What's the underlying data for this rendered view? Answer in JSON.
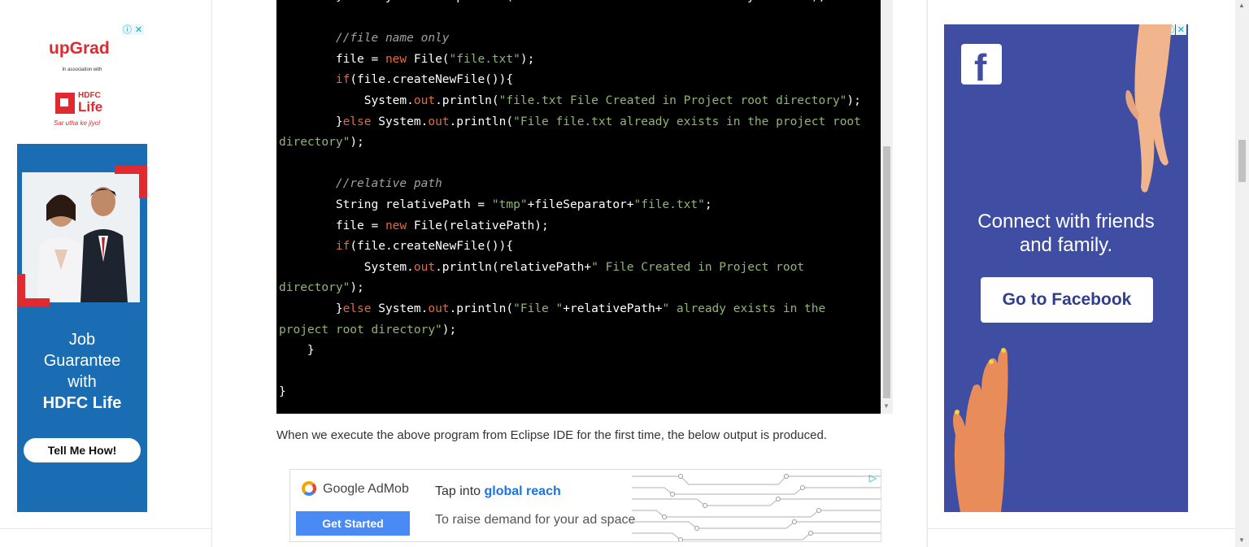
{
  "left_ad": {
    "brand": "upGrad",
    "association": "In association with",
    "partner_top": "HDFC",
    "partner_bottom": "Life",
    "tagline": "Sar utha ke jiyo!",
    "headline_lines": [
      "Job",
      "Guarantee",
      "with"
    ],
    "headline_bold": "HDFC Life",
    "cta": "Tell Me How!",
    "badge_info": "ⓘ",
    "badge_close": "✕"
  },
  "code": {
    "lines": [
      [
        {
          "t": "        }else System.out.println(\"File \"+absoluteFilePath+\" already exists\");",
          "c": ""
        }
      ],
      [
        {
          "t": "",
          "c": ""
        }
      ],
      [
        {
          "t": "        ",
          "c": ""
        },
        {
          "t": "//file name only",
          "c": "c-com"
        }
      ],
      [
        {
          "t": "        file = ",
          "c": ""
        },
        {
          "t": "new",
          "c": "c-kw"
        },
        {
          "t": " File(",
          "c": ""
        },
        {
          "t": "\"file.txt\"",
          "c": "c-str"
        },
        {
          "t": ");",
          "c": ""
        }
      ],
      [
        {
          "t": "        ",
          "c": ""
        },
        {
          "t": "if",
          "c": "c-kw"
        },
        {
          "t": "(file.createNewFile()){",
          "c": ""
        }
      ],
      [
        {
          "t": "            System.",
          "c": ""
        },
        {
          "t": "out",
          "c": "c-fld"
        },
        {
          "t": ".println(",
          "c": ""
        },
        {
          "t": "\"file.txt File Created in Project root directory\"",
          "c": "c-str"
        },
        {
          "t": ");",
          "c": ""
        }
      ],
      [
        {
          "t": "        }",
          "c": ""
        },
        {
          "t": "else",
          "c": "c-kw"
        },
        {
          "t": " System.",
          "c": ""
        },
        {
          "t": "out",
          "c": "c-fld"
        },
        {
          "t": ".println(",
          "c": ""
        },
        {
          "t": "\"File file.txt already exists in the project root",
          "c": "c-str"
        }
      ],
      [
        {
          "t": "directory\"",
          "c": "c-str"
        },
        {
          "t": ");",
          "c": ""
        }
      ],
      [
        {
          "t": "",
          "c": ""
        }
      ],
      [
        {
          "t": "        ",
          "c": ""
        },
        {
          "t": "//relative path",
          "c": "c-com"
        }
      ],
      [
        {
          "t": "        String relativePath = ",
          "c": ""
        },
        {
          "t": "\"tmp\"",
          "c": "c-str"
        },
        {
          "t": "+fileSeparator+",
          "c": ""
        },
        {
          "t": "\"file.txt\"",
          "c": "c-str"
        },
        {
          "t": ";",
          "c": ""
        }
      ],
      [
        {
          "t": "        file = ",
          "c": ""
        },
        {
          "t": "new",
          "c": "c-kw"
        },
        {
          "t": " File(relativePath);",
          "c": ""
        }
      ],
      [
        {
          "t": "        ",
          "c": ""
        },
        {
          "t": "if",
          "c": "c-kw"
        },
        {
          "t": "(file.createNewFile()){",
          "c": ""
        }
      ],
      [
        {
          "t": "            System.",
          "c": ""
        },
        {
          "t": "out",
          "c": "c-fld"
        },
        {
          "t": ".println(relativePath+",
          "c": ""
        },
        {
          "t": "\" File Created in Project root",
          "c": "c-str"
        }
      ],
      [
        {
          "t": "directory\"",
          "c": "c-str"
        },
        {
          "t": ");",
          "c": ""
        }
      ],
      [
        {
          "t": "        }",
          "c": ""
        },
        {
          "t": "else",
          "c": "c-kw"
        },
        {
          "t": " System.",
          "c": ""
        },
        {
          "t": "out",
          "c": "c-fld"
        },
        {
          "t": ".println(",
          "c": ""
        },
        {
          "t": "\"File \"",
          "c": "c-str"
        },
        {
          "t": "+relativePath+",
          "c": ""
        },
        {
          "t": "\" already exists in the",
          "c": "c-str"
        }
      ],
      [
        {
          "t": "project root directory\"",
          "c": "c-str"
        },
        {
          "t": ");",
          "c": ""
        }
      ],
      [
        {
          "t": "    }",
          "c": ""
        }
      ],
      [
        {
          "t": "",
          "c": ""
        }
      ],
      [
        {
          "t": "}",
          "c": ""
        }
      ]
    ]
  },
  "paragraph": "When we execute the above program from Eclipse IDE for the first time, the below output is produced.",
  "bottom_ad": {
    "brand": "Google AdMob",
    "cta": "Get Started",
    "line1_prefix": "Tap into ",
    "line1_bold": "global reach",
    "line2": "To raise demand for your ad space",
    "adchoices": "▷"
  },
  "right_ad": {
    "logo": "f",
    "headline_line1": "Connect with friends",
    "headline_line2": "and family.",
    "cta": "Go to Facebook",
    "badge_info": "ⓘ",
    "badge_close": "✕"
  },
  "colors": {
    "facebook_blue": "#3f4ea3",
    "hdfc_red": "#e02a2f",
    "hdfc_blue": "#1b6db3",
    "admob_button": "#4a8af4"
  }
}
